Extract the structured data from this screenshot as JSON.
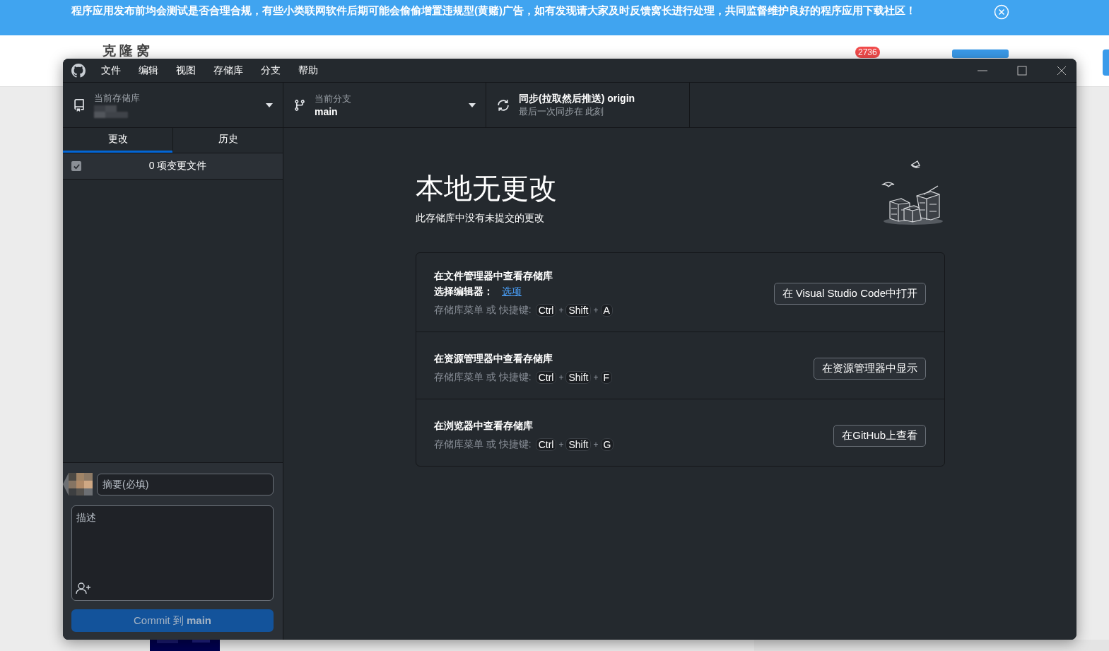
{
  "banner": {
    "text": "程序应用发布前均会测试是否合理合规，有些小类联网软件后期可能会偷偷增置违规型(黄赌)广告，如有发现请大家及时反馈窝长进行处理，共同监督维护良好的程序应用下载社区！"
  },
  "site": {
    "logo": "克 隆 窝",
    "badge": "2736"
  },
  "window": {
    "menu": [
      "文件",
      "编辑",
      "视图",
      "存储库",
      "分支",
      "帮助"
    ],
    "repo": {
      "label": "当前存储库"
    },
    "branch": {
      "label": "当前分支",
      "value": "main"
    },
    "sync": {
      "title": "同步(拉取然后推送) origin",
      "subtitle": "最后一次同步在 此刻"
    },
    "tabs": [
      {
        "label": "更改",
        "selected": true
      },
      {
        "label": "历史",
        "selected": false
      }
    ],
    "changes": {
      "label": "0 项变更文件",
      "checked": true
    },
    "summary": {
      "placeholder": "摘要(必填)"
    },
    "description": {
      "placeholder": "描述"
    },
    "commit_button": {
      "text": "Commit 到 **main**",
      "disabled": true
    },
    "empty": {
      "title": "本地无更改",
      "subtitle": "此存储库中没有未提交的更改"
    },
    "actions": [
      {
        "title": "在文件管理器中查看存储库",
        "editor_label": "选择编辑器：",
        "editor_link": "选项",
        "shortcut_label": "存储库菜单 或 快捷键:",
        "keys": [
          "Ctrl",
          "Shift",
          "A"
        ],
        "separator": "+",
        "button": "在 Visual Studio Code中打开"
      },
      {
        "title": "在资源管理器中查看存储库",
        "shortcut_label": "存储库菜单 或 快捷键:",
        "keys": [
          "Ctrl",
          "Shift",
          "F"
        ],
        "separator": "+",
        "button": "在资源管理器中显示"
      },
      {
        "title": "在浏览器中查看存储库",
        "shortcut_label": "存储库菜单 或 快捷键:",
        "keys": [
          "Ctrl",
          "Shift",
          "G"
        ],
        "separator": "+",
        "button": "在GitHub上查看"
      }
    ]
  }
}
